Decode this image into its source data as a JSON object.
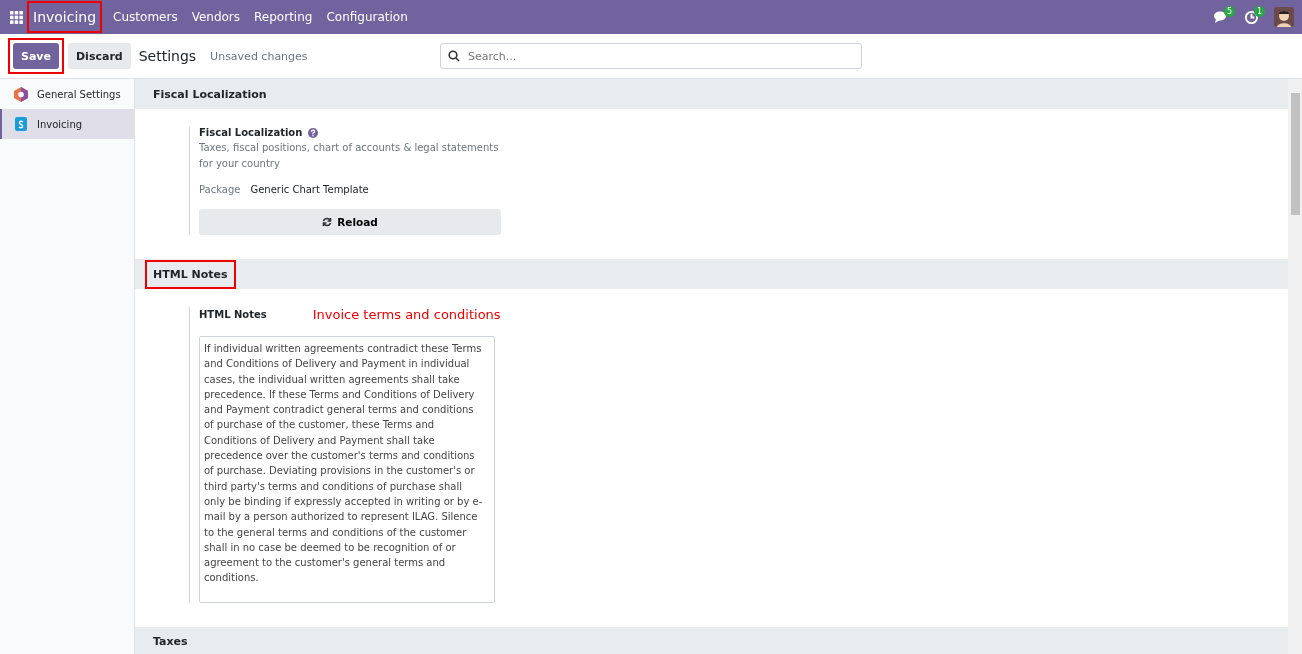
{
  "navbar": {
    "app": {
      "label": "Invoicing",
      "highlighted": true
    },
    "menu": [
      "Customers",
      "Vendors",
      "Reporting",
      "Configuration"
    ],
    "messages_badge": "5",
    "activities_badge": "1"
  },
  "control_bar": {
    "save": {
      "label": "Save",
      "highlighted": true
    },
    "discard": "Discard",
    "title": "Settings",
    "status": "Unsaved changes",
    "search": {
      "placeholder": "Search..."
    }
  },
  "sidebar": {
    "items": [
      {
        "label": "General Settings",
        "kind": "general",
        "selected": false
      },
      {
        "label": "Invoicing",
        "kind": "invoicing",
        "selected": true
      }
    ]
  },
  "sections": [
    {
      "title": "Fiscal Localization",
      "highlighted": false,
      "kind": "fiscal",
      "setting": {
        "label": "Fiscal Localization",
        "description": "Taxes, fiscal positions, chart of accounts & legal statements for your country",
        "field_label": "Package",
        "field_value": "Generic Chart Template",
        "button": "Reload"
      }
    },
    {
      "title": "HTML Notes",
      "highlighted": true,
      "kind": "notes",
      "setting": {
        "label": "HTML Notes",
        "annotation": "Invoice terms and conditions",
        "value": "If individual written agreements contradict these Terms and Conditions of Delivery and Payment in individual cases, the individual written agreements shall take precedence. If these Terms and Conditions of Delivery and Payment contradict general terms and conditions of purchase of the customer, these Terms and Conditions of Delivery and Payment shall take precedence over the customer's terms and conditions of purchase. Deviating provisions in the customer's or third party's terms and conditions of purchase shall only be binding if expressly accepted in writing or by e-mail by a person authorized to represent ILAG. Silence to the general terms and conditions of the customer shall in no case be deemed to be recognition of or agreement to the customer's general terms and conditions."
      }
    },
    {
      "title": "Taxes",
      "highlighted": false
    }
  ]
}
